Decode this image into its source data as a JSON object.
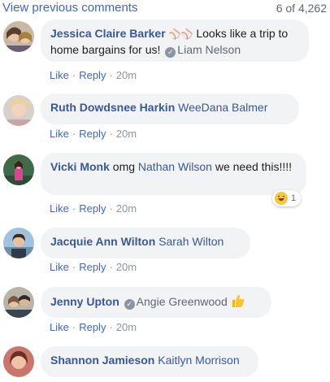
{
  "header": {
    "view_previous": "View previous comments",
    "count": "6 of 4,262"
  },
  "actions": {
    "like": "Like",
    "reply": "Reply",
    "sep": "·"
  },
  "comments": [
    {
      "author": "Jessica Claire Barker",
      "emoji_text": "⚾️⚾️",
      "text": "Looks like a trip to home bargains for us!",
      "mention": "Liam Nelson",
      "time": "20m"
    },
    {
      "author": "Ruth Dowdsnee Harkin",
      "mention": "WeeDana Balmer",
      "time": "20m"
    },
    {
      "author": "Vicki Monk",
      "text_before": "omg",
      "mention": "Nathan Wilson",
      "text_after": "we need this!!!!",
      "time": "20m",
      "reaction_count": "1"
    },
    {
      "author": "Jacquie Ann Wilton",
      "mention": "Sarah Wilton",
      "time": "20m"
    },
    {
      "author": "Jenny Upton",
      "mention": "Angie Greenwood",
      "time": "20m"
    },
    {
      "author": "Shannon Jamieson",
      "mention": "Kaitlyn Morrison"
    }
  ],
  "colors": {
    "link": "#385898",
    "bubble": "#f2f3f5",
    "meta": "#8d949e"
  },
  "icons": [
    "verified-badge-icon",
    "haha-reaction-icon",
    "thumbs-up-icon"
  ]
}
